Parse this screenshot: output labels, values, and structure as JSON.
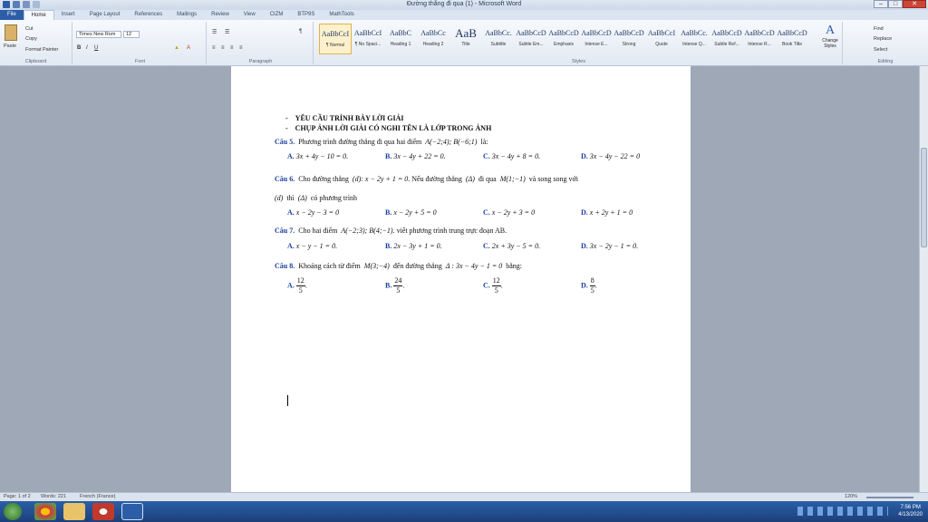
{
  "window": {
    "title": "Đường thẳng đi qua (1) - Microsoft Word"
  },
  "tabs": [
    "File",
    "Home",
    "Insert",
    "Page Layout",
    "References",
    "Mailings",
    "Review",
    "View",
    "CIZM",
    "BTP9S",
    "MathTools"
  ],
  "clipboard": {
    "paste": "Paste",
    "cut": "Cut",
    "copy": "Copy",
    "format_painter": "Format Painter",
    "label": "Clipboard"
  },
  "font": {
    "name": "Times New Rom",
    "size": "12",
    "label": "Font"
  },
  "paragraph": {
    "label": "Paragraph"
  },
  "styles": {
    "label": "Styles",
    "items": [
      {
        "preview": "AaBbCcI",
        "name": "¶ Normal"
      },
      {
        "preview": "AaBbCcI",
        "name": "¶ No Spaci..."
      },
      {
        "preview": "AaBbC",
        "name": "Heading 1"
      },
      {
        "preview": "AaBbCc",
        "name": "Heading 2"
      },
      {
        "preview": "AaB",
        "name": "Title"
      },
      {
        "preview": "AaBbCc.",
        "name": "Subtitle"
      },
      {
        "preview": "AaBbCcD",
        "name": "Subtle Em..."
      },
      {
        "preview": "AaBbCcD",
        "name": "Emphasis"
      },
      {
        "preview": "AaBbCcD",
        "name": "Intense E..."
      },
      {
        "preview": "AaBbCcD",
        "name": "Strong"
      },
      {
        "preview": "AaBbCcI",
        "name": "Quote"
      },
      {
        "preview": "AaBbCc.",
        "name": "Intense Q..."
      },
      {
        "preview": "AaBbCcD",
        "name": "Subtle Ref..."
      },
      {
        "preview": "AaBbCcD",
        "name": "Intense R..."
      },
      {
        "preview": "AaBbCcD",
        "name": "Book Title"
      }
    ],
    "change": "Change Styles"
  },
  "editing": {
    "find": "Find",
    "replace": "Replace",
    "select": "Select",
    "label": "Editing"
  },
  "doc": {
    "h1": "YÊU CẦU TRÌNH BÀY LỜI GIẢI",
    "h2": "CHỤP ẢNH LỜI GIẢI CÓ NGHI TÊN LÀ LỚP TRONG ẢNH",
    "q5": {
      "label": "Câu 5.",
      "text": "Phương trình đường thẳng đi qua hai điểm",
      "pts": "A(−2;4); B(−6;1)",
      "tail": "là:",
      "A": "3x + 4y − 10 = 0.",
      "B": "3x − 4y + 22 = 0.",
      "C": "3x − 4y + 8 = 0.",
      "D": "3x − 4y − 22 = 0"
    },
    "q6": {
      "label": "Câu 6.",
      "t1": "Cho đường thẳng",
      "eq": "(d): x − 2y + 1 = 0",
      "t2": ". Nếu đường thẳng",
      "delta": "(Δ)",
      "t3": "đi qua",
      "m": "M(1;−1)",
      "t4": "và song song với",
      "d": "(d)",
      "t5": "thì",
      "delta2": "(Δ)",
      "t6": "có phương trình",
      "A": "x − 2y − 3 = 0",
      "B": "x − 2y + 5 = 0",
      "C": "x − 2y + 3 = 0",
      "D": "x + 2y + 1 = 0"
    },
    "q7": {
      "label": "Câu 7.",
      "text": "Cho hai điểm",
      "pts": "A(−2;3); B(4;−1)",
      "tail": ". viết phương trình trung trực đoạn AB.",
      "A": "x − y − 1 = 0.",
      "B": "2x − 3y + 1 = 0.",
      "C": "2x + 3y − 5 = 0.",
      "D": "3x − 2y − 1 = 0."
    },
    "q8": {
      "label": "Câu 8.",
      "text": "Khoảng cách từ điểm",
      "m": "M(3;−4)",
      "mid": "đến đường thẳng",
      "line": "Δ : 3x − 4y − 1 = 0",
      "tail": "bằng:",
      "A": {
        "n": "12",
        "d": "5"
      },
      "B": {
        "n": "24",
        "d": "5"
      },
      "C": {
        "n": "12",
        "d": "5"
      },
      "D": {
        "n": "8",
        "d": "5"
      }
    },
    "letters": {
      "A": "A.",
      "B": "B.",
      "C": "C.",
      "D": "D."
    }
  },
  "status": {
    "page": "Page: 1 of 2",
    "words": "Words: 221",
    "lang": "French (France)",
    "zoom": "120%"
  },
  "clock": {
    "time": "7:56 PM",
    "date": "4/13/2020"
  }
}
